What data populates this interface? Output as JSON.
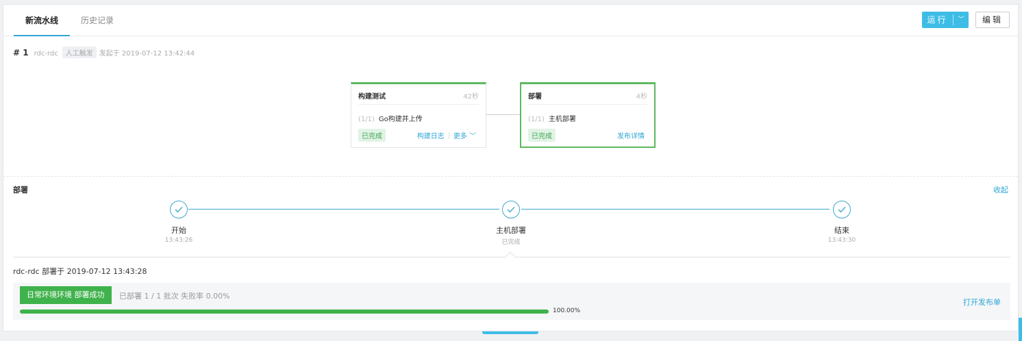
{
  "tabs": [
    {
      "label": "新流水线",
      "active": true
    },
    {
      "label": "历史记录",
      "active": false
    }
  ],
  "toolbar": {
    "run_label": "运行",
    "run_caret": "﹀",
    "edit_label": "编辑"
  },
  "run": {
    "number": "# 1",
    "pipeline": "rdc-rdc",
    "trigger": "人工触发",
    "started": "发起于 2019-07-12 13:42:44"
  },
  "stages": [
    {
      "title": "构建测试",
      "duration": "42秒",
      "job_index": "(1/1)",
      "job_name": "Go构建并上传",
      "status": "已完成",
      "links": [
        "构建日志",
        "更多 ﹀"
      ]
    },
    {
      "title": "部署",
      "duration": "4秒",
      "job_index": "(1/1)",
      "job_name": "主机部署",
      "status": "已完成",
      "links": [
        "发布详情"
      ]
    }
  ],
  "deploy": {
    "section_title": "部署",
    "collapse_label": "收起",
    "steps": [
      {
        "name": "开始",
        "sub": "13:43:26"
      },
      {
        "name": "主机部署",
        "sub": "已完成"
      },
      {
        "name": "结束",
        "sub": "13:43:30"
      }
    ],
    "summary": "rdc-rdc 部署于 2019-07-12 13:43:28",
    "status_label": "日常环境环境 部署成功",
    "stats": "已部署 1 / 1 批次  失败率 0.00%",
    "progress": 1.0,
    "progress_text": "100.00%",
    "open_link": "打开发布单"
  },
  "colors": {
    "accent": "#3dbde5",
    "success": "#3fb24c",
    "link": "#2ea6d4"
  }
}
